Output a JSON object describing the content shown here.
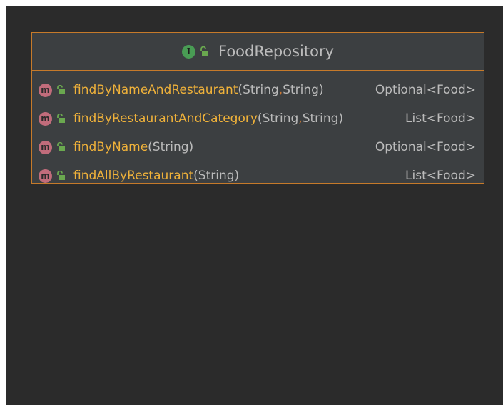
{
  "diagram": {
    "interface_badge": "I",
    "title": "FoodRepository",
    "method_badge": "m",
    "methods": [
      {
        "name": "findByNameAndRestaurant",
        "p_open": "(",
        "p1": "String",
        "sep": ",",
        "p2": " String",
        "p_close": ")",
        "return_type": "Optional<Food>"
      },
      {
        "name": "findByRestaurantAndCategory",
        "p_open": "(",
        "p1": "String",
        "sep": ",",
        "p2": " String",
        "p_close": ")",
        "return_type": "List<Food>"
      },
      {
        "name": "findByName",
        "p_open": "(",
        "p1": "String",
        "sep": "",
        "p2": "",
        "p_close": ")",
        "return_type": "Optional<Food>"
      },
      {
        "name": "findAllByRestaurant",
        "p_open": "(",
        "p1": "String",
        "sep": "",
        "p2": "",
        "p_close": ")",
        "return_type": "List<Food>"
      }
    ]
  },
  "colors": {
    "canvas_bg": "#2b2b2b",
    "node_bg": "#3c3f41",
    "node_border": "#c67a2a",
    "interface_icon": "#499c54",
    "method_icon": "#c16c7b",
    "method_name": "#f0b23a",
    "lock_icon": "#6aa84f"
  },
  "icons": [
    "interface-icon",
    "public-lock-icon",
    "method-icon"
  ]
}
